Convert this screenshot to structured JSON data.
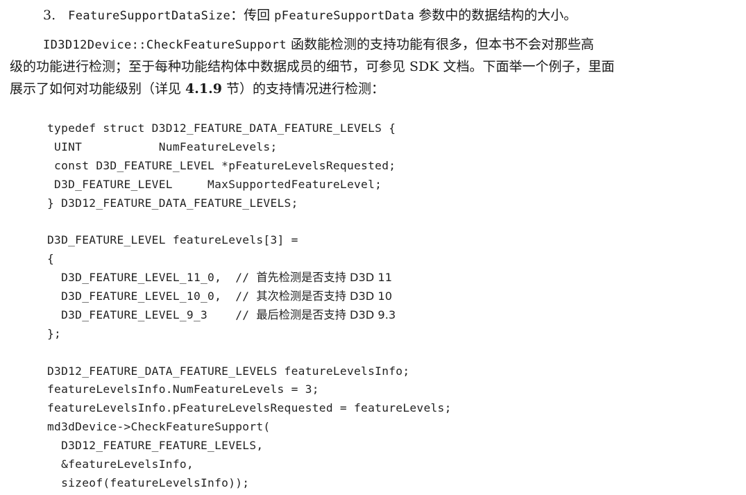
{
  "item": {
    "number": "3.",
    "term": "FeatureSupportDataSize",
    "text_a": "：传回 ",
    "param": "pFeatureSupportData",
    "text_b": " 参数中的数据结构的大小。"
  },
  "paragraph": {
    "func": "ID3D12Device::CheckFeatureSupport",
    "line1_rest": " 函数能检测的支持功能有很多，但本书不会对那些高",
    "line2": "级的功能进行检测；至于每种功能结构体中数据成员的细节，可参见 SDK 文档。下面举一个例子，里面",
    "line3_a": "展示了如何对功能级别（详见 ",
    "section": "4.1.9",
    "line3_b": " 节）的支持情况进行检测："
  },
  "code": {
    "lines": [
      {
        "code": "typedef struct D3D12_FEATURE_DATA_FEATURE_LEVELS {",
        "comment": ""
      },
      {
        "code": " UINT           NumFeatureLevels;",
        "comment": ""
      },
      {
        "code": " const D3D_FEATURE_LEVEL *pFeatureLevelsRequested;",
        "comment": ""
      },
      {
        "code": " D3D_FEATURE_LEVEL     MaxSupportedFeatureLevel;",
        "comment": ""
      },
      {
        "code": "} D3D12_FEATURE_DATA_FEATURE_LEVELS;",
        "comment": ""
      },
      {
        "code": "",
        "comment": ""
      },
      {
        "code": "D3D_FEATURE_LEVEL featureLevels[3] =",
        "comment": ""
      },
      {
        "code": "{",
        "comment": ""
      },
      {
        "code": "  D3D_FEATURE_LEVEL_11_0,  // ",
        "comment": "首先检测是否支持 D3D 11"
      },
      {
        "code": "  D3D_FEATURE_LEVEL_10_0,  // ",
        "comment": "其次检测是否支持 D3D 10"
      },
      {
        "code": "  D3D_FEATURE_LEVEL_9_3    // ",
        "comment": "最后检测是否支持 D3D 9.3"
      },
      {
        "code": "};",
        "comment": ""
      },
      {
        "code": "",
        "comment": ""
      },
      {
        "code": "D3D12_FEATURE_DATA_FEATURE_LEVELS featureLevelsInfo;",
        "comment": ""
      },
      {
        "code": "featureLevelsInfo.NumFeatureLevels = 3;",
        "comment": ""
      },
      {
        "code": "featureLevelsInfo.pFeatureLevelsRequested = featureLevels;",
        "comment": ""
      },
      {
        "code": "md3dDevice->CheckFeatureSupport(",
        "comment": ""
      },
      {
        "code": "  D3D12_FEATURE_FEATURE_LEVELS,",
        "comment": ""
      },
      {
        "code": "  &featureLevelsInfo,",
        "comment": ""
      },
      {
        "code": "  sizeof(featureLevelsInfo));",
        "comment": ""
      }
    ]
  }
}
